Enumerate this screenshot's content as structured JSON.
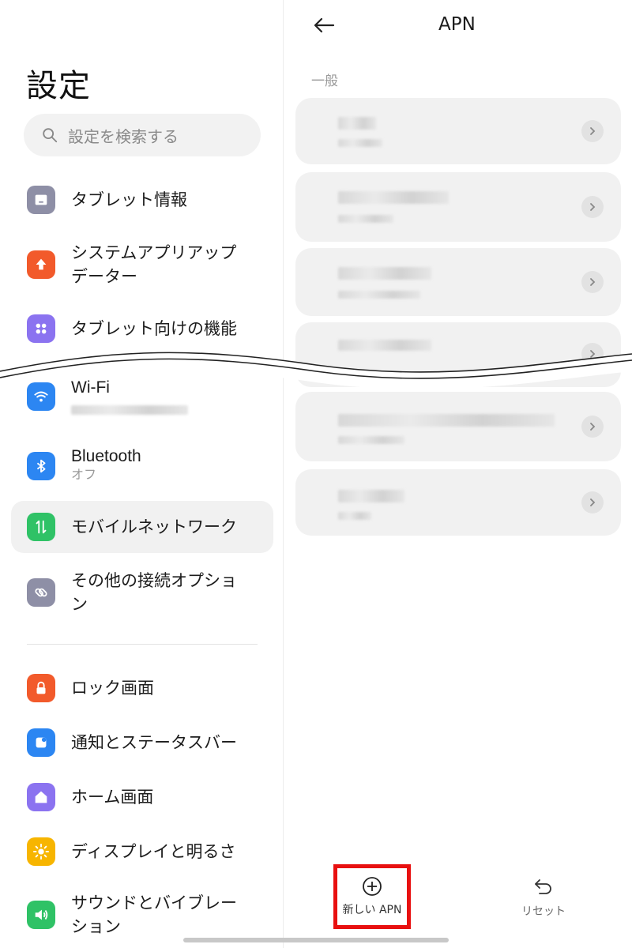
{
  "settings": {
    "title": "設定",
    "search_placeholder": "設定を検索する",
    "items": [
      {
        "label": "タブレット情報",
        "icon": "tablet-icon",
        "color": "#8e8fa6"
      },
      {
        "label": "システムアプリアップ",
        "label2": "データー",
        "icon": "arrow-up-icon",
        "color": "#f25a2b"
      },
      {
        "label": "タブレット向けの機能",
        "icon": "grid-icon",
        "color": "#8b73f0"
      },
      {
        "label": "Wi-Fi",
        "icon": "wifi-icon",
        "color": "#2c86f2"
      },
      {
        "label": "Bluetooth",
        "sub": "オフ",
        "icon": "bluetooth-icon",
        "color": "#2c86f2"
      },
      {
        "label": "モバイルネットワーク",
        "icon": "mobile-network-icon",
        "color": "#2fc266"
      },
      {
        "label": "その他の接続オプショ",
        "label2": "ン",
        "icon": "link-icon",
        "color": "#8e8fa6"
      },
      {
        "label": "ロック画面",
        "icon": "lock-icon",
        "color": "#f25a2b"
      },
      {
        "label": "通知とステータスバー",
        "icon": "notification-icon",
        "color": "#2c86f2"
      },
      {
        "label": "ホーム画面",
        "icon": "home-icon",
        "color": "#8b73f0"
      },
      {
        "label": "ディスプレイと明るさ",
        "icon": "brightness-icon",
        "color": "#f7b500"
      },
      {
        "label": "サウンドとバイブレー",
        "label2": "ション",
        "icon": "sound-icon",
        "color": "#2fc266"
      }
    ]
  },
  "apn": {
    "title": "APN",
    "section": "一般",
    "new_label": "新しい APN",
    "reset_label": "リセット"
  }
}
